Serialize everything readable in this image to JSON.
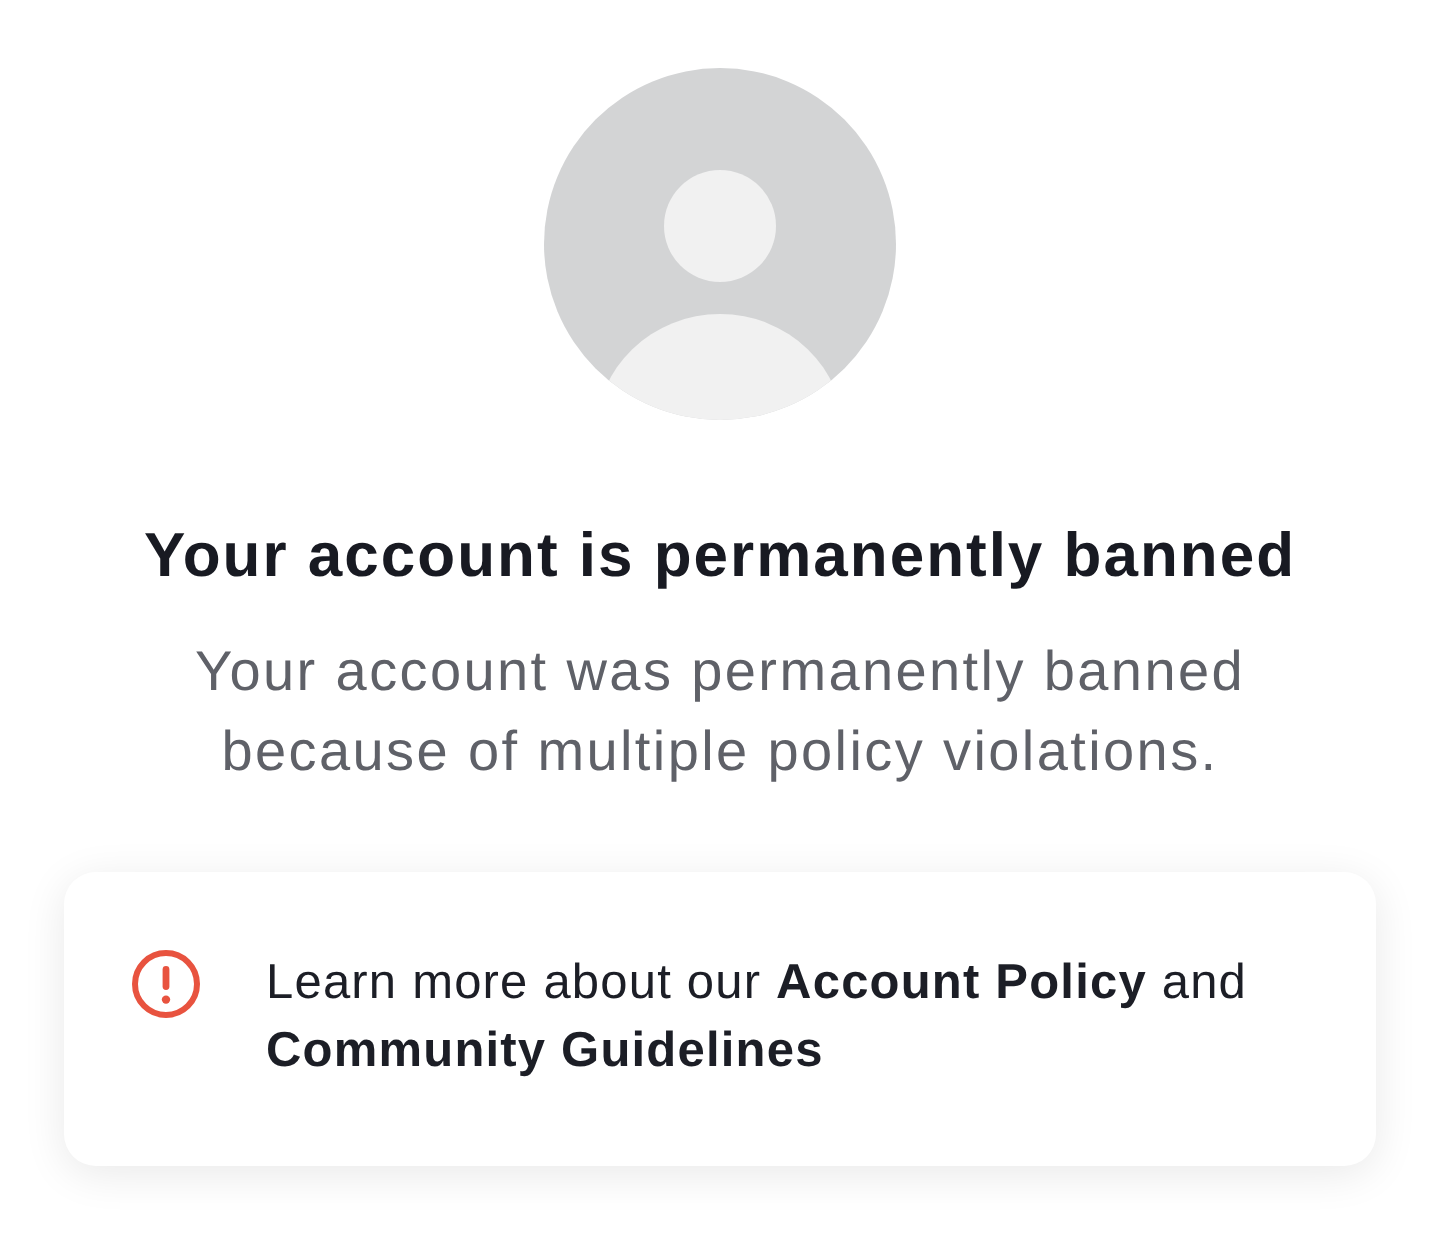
{
  "title": "Your account is permanently banned",
  "message": "Your account was permanently banned because of multiple policy violations.",
  "notice": {
    "parts": [
      {
        "kind": "text",
        "text": "Learn more about our"
      },
      {
        "kind": "link",
        "text": "Account Policy"
      },
      {
        "kind": "text",
        "text": "and"
      },
      {
        "kind": "link",
        "text": "Community Guidelines"
      }
    ]
  }
}
